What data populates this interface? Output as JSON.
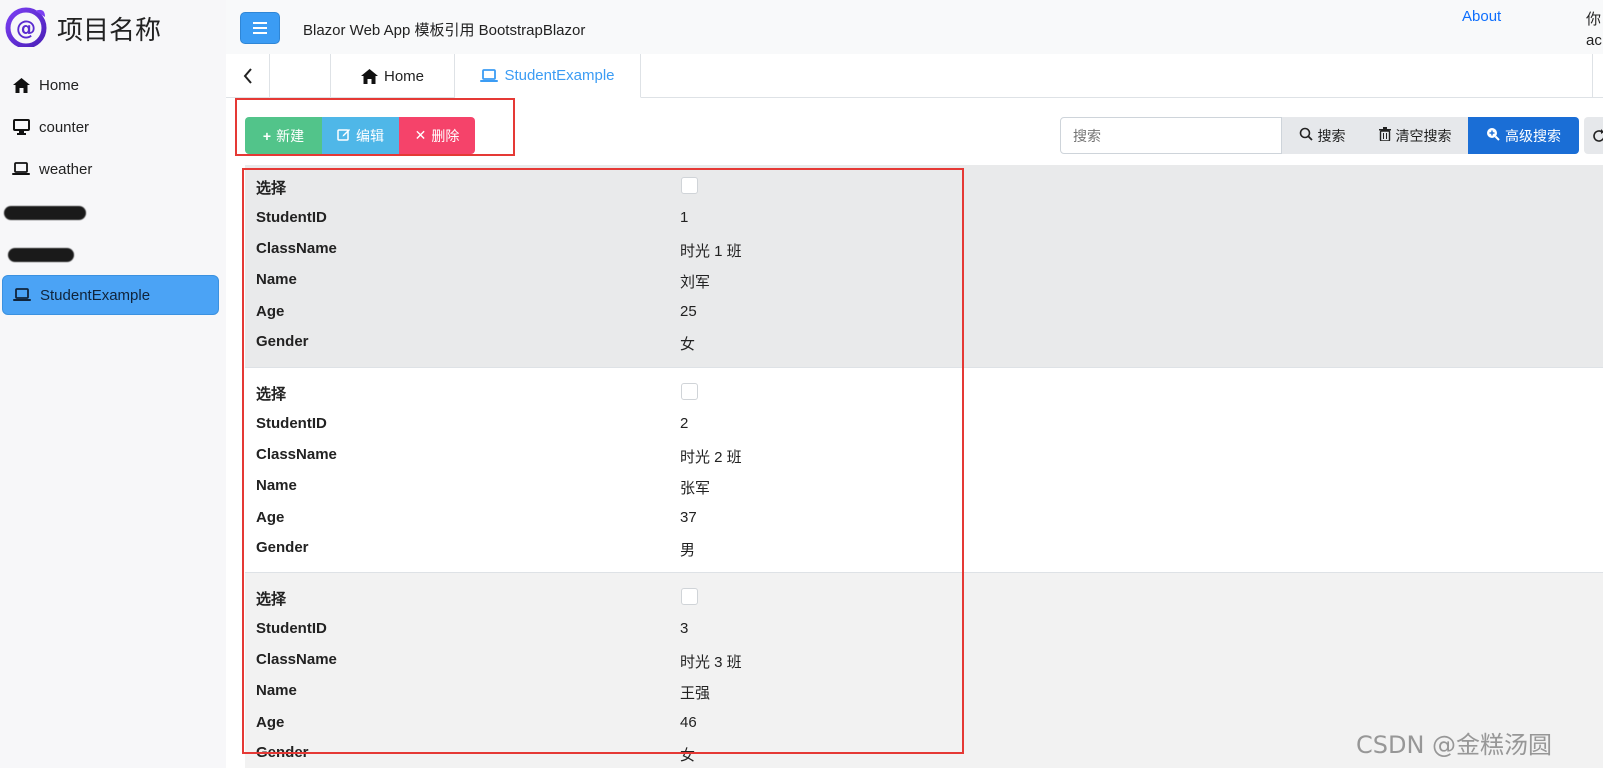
{
  "brand": {
    "title": "项目名称"
  },
  "sidebar": {
    "items": [
      {
        "label": "Home",
        "icon": "home-icon"
      },
      {
        "label": "counter",
        "icon": "monitor-icon"
      },
      {
        "label": "weather",
        "icon": "laptop-icon"
      },
      {
        "label": "StudentExample",
        "icon": "laptop-icon",
        "active": true
      }
    ]
  },
  "header": {
    "title": "Blazor Web App 模板引用 BootstrapBlazor",
    "about": "About",
    "user_line1": "你",
    "user_line2": "ac"
  },
  "tabs": [
    {
      "label": "Home"
    },
    {
      "label": "StudentExample",
      "active": true
    }
  ],
  "toolbar": {
    "new_label": "新建",
    "edit_label": "编辑",
    "delete_label": "删除"
  },
  "search": {
    "placeholder": "搜索",
    "search_label": "搜索",
    "clear_label": "清空搜索",
    "advanced_label": "高级搜索"
  },
  "table": {
    "fields": [
      "选择",
      "StudentID",
      "ClassName",
      "Name",
      "Age",
      "Gender"
    ],
    "rows": [
      {
        "StudentID": "1",
        "ClassName": "时光 1 班",
        "Name": "刘军",
        "Age": "25",
        "Gender": "女"
      },
      {
        "StudentID": "2",
        "ClassName": "时光 2 班",
        "Name": "张军",
        "Age": "37",
        "Gender": "男"
      },
      {
        "StudentID": "3",
        "ClassName": "时光 3 班",
        "Name": "王强",
        "Age": "46",
        "Gender": "女"
      }
    ]
  },
  "watermark": "CSDN @金糕汤圆",
  "colors": {
    "accent": "#3b9cf4",
    "success": "#52c48a",
    "info": "#4fb7e8",
    "danger": "#f5436a",
    "primary": "#1a6ed6",
    "highlight": "#e53935"
  }
}
